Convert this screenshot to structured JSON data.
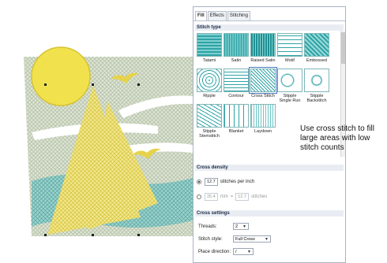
{
  "tabs": [
    "Fill",
    "Effects",
    "Stitching"
  ],
  "sections": {
    "stitch_type": "Stitch type",
    "cross_density": "Cross density",
    "cross_settings": "Cross settings"
  },
  "stitch_types": [
    {
      "label": "Tatami",
      "icon": "tatami-icon"
    },
    {
      "label": "Satin",
      "icon": "satin-icon"
    },
    {
      "label": "Raised Satin",
      "icon": "raised-satin-icon"
    },
    {
      "label": "Motif",
      "icon": "motif-icon"
    },
    {
      "label": "Embossed",
      "icon": "embossed-icon"
    },
    {
      "label": "Ripple",
      "icon": "ripple-icon"
    },
    {
      "label": "Contour",
      "icon": "contour-icon"
    },
    {
      "label": "Cross Stitch",
      "icon": "cross-stitch-icon",
      "selected": true
    },
    {
      "label": "Stipple Single Run",
      "icon": "stipple-single-run-icon"
    },
    {
      "label": "Stipple Backstitch",
      "icon": "stipple-backstitch-icon"
    },
    {
      "label": "Stipple Stemstitch",
      "icon": "stipple-stemstitch-icon"
    },
    {
      "label": "Blanket",
      "icon": "blanket-icon"
    },
    {
      "label": "Laydown",
      "icon": "laydown-icon"
    }
  ],
  "density": {
    "per_inch_value": "12.7",
    "per_inch_label": "stitches per inch",
    "mm_value": "25.4",
    "mm_unit": "mm",
    "mm_eq": "=",
    "mm_count": "12.7",
    "mm_label": "stitches"
  },
  "settings": {
    "threads_label": "Threads:",
    "threads_value": "2",
    "style_label": "Stitch style:",
    "style_value": "Full Cross",
    "direction_label": "Place direction:",
    "direction_value": "/"
  },
  "callout": "Use cross stitch to fill large areas with low stitch counts",
  "colors": {
    "panel_border": "#a9b4c4",
    "accent": "#2fa3a6",
    "sun": "#f1e24d",
    "sail": "#efe27a",
    "sea": "#7fc4c0"
  }
}
